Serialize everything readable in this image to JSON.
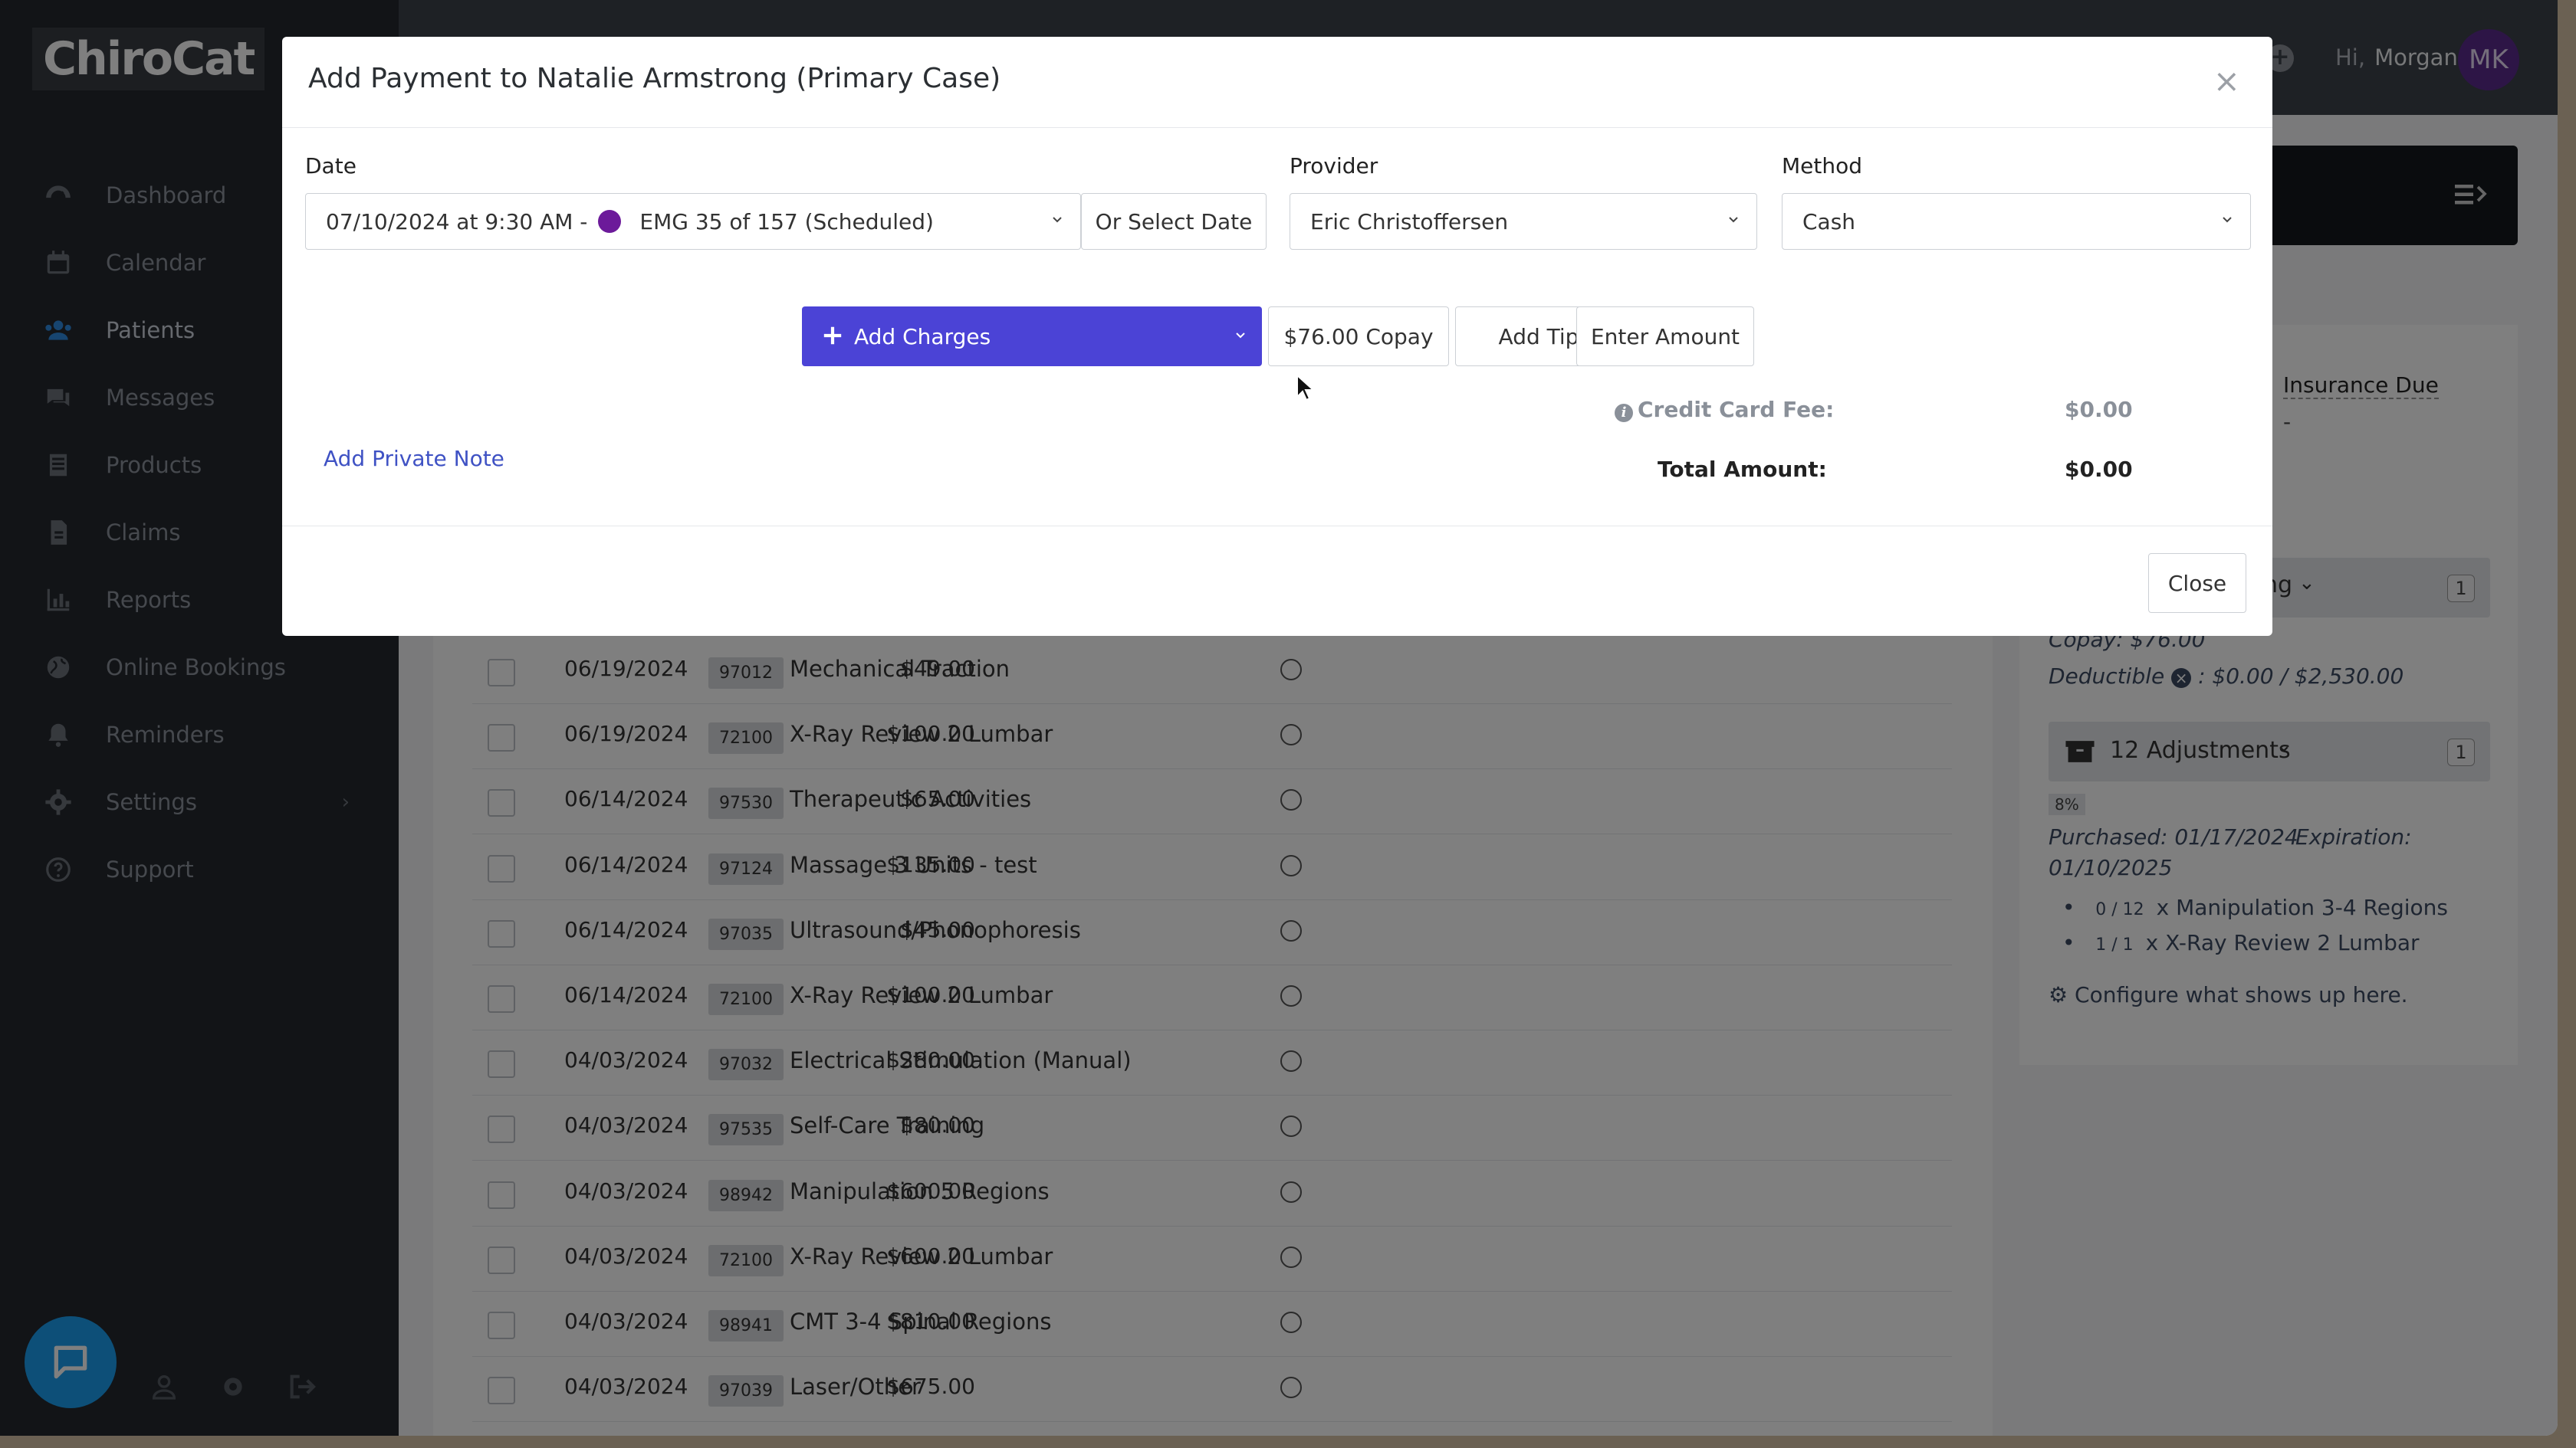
{
  "app": {
    "logo": "ChiroCat"
  },
  "sidebar": {
    "items": [
      {
        "label": "Dashboard",
        "icon": "dashboard-icon"
      },
      {
        "label": "Calendar",
        "icon": "calendar-icon"
      },
      {
        "label": "Patients",
        "icon": "patients-icon",
        "active": true
      },
      {
        "label": "Messages",
        "icon": "messages-icon"
      },
      {
        "label": "Products",
        "icon": "products-icon"
      },
      {
        "label": "Claims",
        "icon": "claims-icon"
      },
      {
        "label": "Reports",
        "icon": "reports-icon"
      },
      {
        "label": "Online Bookings",
        "icon": "globe-icon"
      },
      {
        "label": "Reminders",
        "icon": "bell-icon"
      },
      {
        "label": "Settings",
        "icon": "gear-icon"
      },
      {
        "label": "Support",
        "icon": "question-icon"
      }
    ]
  },
  "header": {
    "greeting": "Hi,",
    "user_name": "Morgan",
    "avatar_initials": "MK"
  },
  "right_panel": {
    "insurance_due_label": "Insurance Due",
    "insurance_due_value": "-",
    "package1": {
      "name_tail": "ng",
      "count": "1",
      "copay": "Copay: $76.00",
      "deductible_label": "Deductible",
      "deductible_value": ": $0.00 / $2,530.00"
    },
    "package2": {
      "name": "12 Adjustments",
      "count": "1",
      "percent": "8%",
      "purchased": "Purchased: 01/17/2024",
      "expiration": "Expiration:",
      "expiration_date": "01/10/2025",
      "items": [
        {
          "qty": "0 / 12",
          "desc": "x Manipulation 3-4 Regions"
        },
        {
          "qty": "1 / 1",
          "desc": "x X-Ray Review 2 Lumbar"
        }
      ]
    },
    "configure_label": "Configure what shows up here."
  },
  "charges_table": {
    "rows": [
      {
        "date": "06/19/2024",
        "code": "97012",
        "description": "Mechanical Traction",
        "amount": "$49.00"
      },
      {
        "date": "06/19/2024",
        "code": "72100",
        "description": "X-Ray Review 2 Lumbar",
        "amount": "$100.00"
      },
      {
        "date": "06/14/2024",
        "code": "97530",
        "description": "Therapeutic Activities",
        "amount": "$65.00"
      },
      {
        "date": "06/14/2024",
        "code": "97124",
        "description": "Massage 3 Units - test",
        "amount": "$135.00"
      },
      {
        "date": "06/14/2024",
        "code": "97035",
        "description": "Ultrasound/Phonophoresis",
        "amount": "$45.00"
      },
      {
        "date": "06/14/2024",
        "code": "72100",
        "description": "X-Ray Review 2 Lumbar",
        "amount": "$100.00"
      },
      {
        "date": "04/03/2024",
        "code": "97032",
        "description": "Electrical Stimulation (Manual)",
        "amount": "$280.00"
      },
      {
        "date": "04/03/2024",
        "code": "97535",
        "description": "Self-Care Training",
        "amount": "$80.00"
      },
      {
        "date": "04/03/2024",
        "code": "98942",
        "description": "Manipulation 5 Regions",
        "amount": "$600.00"
      },
      {
        "date": "04/03/2024",
        "code": "72100",
        "description": "X-Ray Review 2 Lumbar",
        "amount": "$600.00"
      },
      {
        "date": "04/03/2024",
        "code": "98941",
        "description": "CMT 3-4 Spinal Regions",
        "amount": "$810.00"
      },
      {
        "date": "04/03/2024",
        "code": "97039",
        "description": "Laser/Other",
        "amount": "$675.00"
      }
    ]
  },
  "modal": {
    "title": "Add Payment to Natalie Armstrong (Primary Case)",
    "date_label": "Date",
    "date_value_prefix": "07/10/2024 at 9:30 AM -",
    "date_value_suffix": "EMG 35 of 157 (Scheduled)",
    "or_select_date": "Or Select Date",
    "provider_label": "Provider",
    "provider_value": "Eric Christoffersen",
    "method_label": "Method",
    "method_value": "Cash",
    "add_charges": "Add Charges",
    "copay_button": "$76.00 Copay",
    "add_tip": "Add Tip",
    "enter_amount": "Enter Amount",
    "credit_card_fee_label": "Credit Card Fee:",
    "credit_card_fee_value": "$0.00",
    "total_label": "Total Amount:",
    "total_value": "$0.00",
    "private_note_link": "Add Private Note",
    "close_button": "Close"
  },
  "colors": {
    "primary": "#4b43d6",
    "sidebar": "#24282e",
    "link": "#3f52c4",
    "appointment_dot": "#6c1a9a",
    "chat": "#1a9ff0"
  }
}
